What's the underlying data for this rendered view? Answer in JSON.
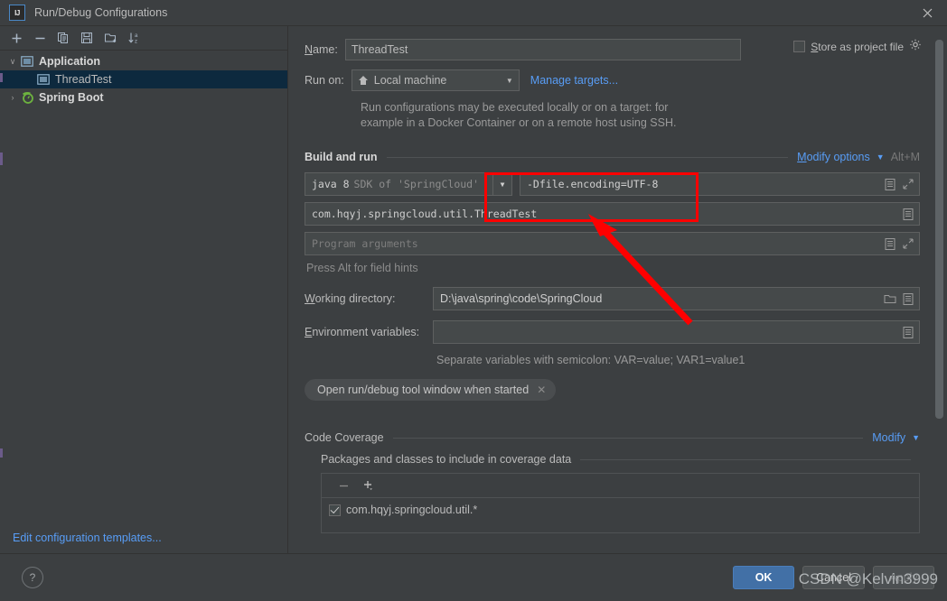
{
  "window": {
    "title": "Run/Debug Configurations",
    "logo_text": "IJ",
    "close_icon": "close-icon"
  },
  "sidebar": {
    "toolbar": [
      {
        "name": "add-configuration-button",
        "icon": "plus-icon",
        "glyph": "+"
      },
      {
        "name": "remove-configuration-button",
        "icon": "minus-icon",
        "glyph": "−"
      },
      {
        "name": "copy-configuration-button",
        "icon": "copy-icon",
        "glyph": "copy"
      },
      {
        "name": "save-configuration-button",
        "icon": "save-icon",
        "glyph": "save"
      },
      {
        "name": "new-folder-button",
        "icon": "folder-add-icon",
        "glyph": "folder"
      },
      {
        "name": "sort-configurations-button",
        "icon": "sort-az-icon",
        "glyph": "sort"
      }
    ],
    "tree": [
      {
        "label": "Application",
        "level": 1,
        "expanded": true,
        "twisty": "∨",
        "icon": "application-icon",
        "bold": true,
        "selected": false
      },
      {
        "label": "ThreadTest",
        "level": 2,
        "expanded": false,
        "twisty": "",
        "icon": "application-icon",
        "bold": false,
        "selected": true
      },
      {
        "label": "Spring Boot",
        "level": 1,
        "expanded": false,
        "twisty": "›",
        "icon": "spring-boot-icon",
        "bold": true,
        "selected": false
      }
    ],
    "edit_templates_label": "Edit configuration templates..."
  },
  "form": {
    "name_label": "Name:",
    "name_label_mnemonic": "N",
    "name_value": "ThreadTest",
    "store_as_project_file_label": "Store as project file",
    "store_as_project_file_mnemonic": "S",
    "store_as_project_file_checked": false,
    "store_gear_icon": "gear-icon",
    "run_on_label": "Run on:",
    "run_on_value": "Local machine",
    "run_on_icon": "home-icon",
    "manage_targets_label": "Manage targets...",
    "run_on_hint_line1": "Run configurations may be executed locally or on a target: for",
    "run_on_hint_line2": "example in a Docker Container or on a remote host using SSH."
  },
  "build_and_run": {
    "section_title": "Build and run",
    "modify_options_label": "Modify options",
    "modify_options_mnemonic": "M",
    "modify_options_shortcut": "Alt+M",
    "jdk_label_bold": "java 8",
    "jdk_label_dim": "SDK of 'SpringCloud'",
    "vm_options_value": "-Dfile.encoding=UTF-8",
    "main_class_value": "com.hqyj.springcloud.util.ThreadTest",
    "program_arguments_placeholder": "Program arguments",
    "press_alt_hint": "Press Alt for field hints",
    "field_icon_expand": "expand-icon",
    "field_icon_macro": "macro-icon"
  },
  "directories": {
    "working_directory_label": "Working directory:",
    "working_directory_mnemonic": "W",
    "working_directory_value": "D:\\java\\spring\\code\\SpringCloud",
    "browse_icon": "folder-open-icon",
    "environment_variables_label": "Environment variables:",
    "environment_variables_mnemonic": "E",
    "environment_variables_value": "",
    "environment_hint": "Separate variables with semicolon: VAR=value; VAR1=value1",
    "chip_label": "Open run/debug tool window when started",
    "chip_close_icon": "close-icon"
  },
  "code_coverage": {
    "section_title": "Code Coverage",
    "modify_label": "Modify",
    "packages_title": "Packages and classes to include in coverage data",
    "toolbar": [
      {
        "name": "remove-package-button",
        "icon": "minus-icon",
        "glyph": "−"
      },
      {
        "name": "add-package-button",
        "icon": "plus-dropdown-icon",
        "glyph": "+"
      }
    ],
    "items": [
      {
        "label": "com.hqyj.springcloud.util.*",
        "checked": true
      }
    ]
  },
  "footer": {
    "help_label": "?",
    "ok_label": "OK",
    "cancel_label": "Cancel",
    "apply_label": "Apply"
  },
  "annotations": {
    "highlight_color": "#ff0000",
    "highlight_target": "vm-options-field",
    "watermark_text": "CSDN @Kelvin3999"
  }
}
